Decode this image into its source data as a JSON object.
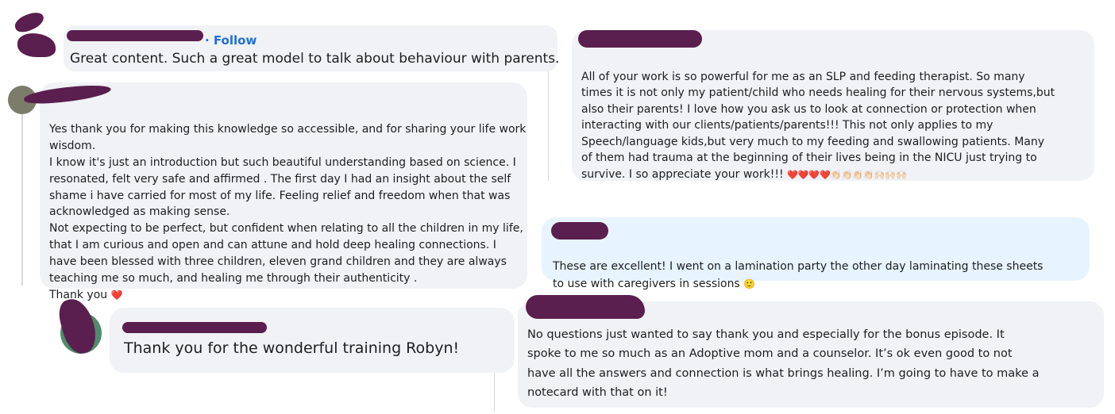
{
  "c1": {
    "follow": "· Follow",
    "text": "Great content. Such a great model to talk about behaviour with parents."
  },
  "c2": {
    "text": "Yes thank you for making this knowledge so accessible, and for sharing your life work\nwisdom.\nI know it's just an introduction but such beautiful understanding based on science. I\nresonated, felt very safe and affirmed . The first day I had an insight about the self\nshame i have carried for most of my life. Feeling relief and freedom when that was\nacknowledged as making sense.\nNot expecting to be perfect, but confident when relating to all the children in my life,\nthat I am curious and open and can attune and hold deep healing connections. I\nhave been blessed with three children, eleven grand children and they are always\nteaching me so much, and healing me through their authenticity .\nThank you",
    "emoji": "❤️"
  },
  "c3": {
    "text": "Thank you for the wonderful training Robyn!"
  },
  "c4": {
    "text": "All of your work is so powerful for me as an SLP and feeding therapist. So many\ntimes it is not only my patient/child who needs healing for their nervous systems,but\nalso their parents! I love how you ask us to look at connection or protection when\ninteracting with our clients/patients/parents!!! This not only applies to my\nSpeech/language kids,but very much to my feeding and swallowing patients. Many\nof them had trauma at the beginning of their lives being in the NICU just trying to\nsurvive. I so appreciate your work!!!",
    "emoji": "❤️❤️❤️❤️👏🏻👏🏻👏🏻👏🏻🙌🏻🙌🏻🙌🏻"
  },
  "c5": {
    "text": "These are excellent! I went on a lamination party the other day laminating these sheets\nto use with caregivers in sessions",
    "emoji": "🙂"
  },
  "c6": {
    "text": "No questions just wanted to say thank you and especially for the bonus episode. It\nspoke to me so much as an Adoptive mom and a counselor. It’s ok even good to not\nhave all the answers and connection is what brings healing. I’m going to have to make a\nnotecard with that on it!"
  },
  "colors": {
    "bubble": "#f0f2f5",
    "bubble_highlight": "#e7f3ff",
    "link": "#216fdb",
    "redaction": "#5a1f4e"
  }
}
